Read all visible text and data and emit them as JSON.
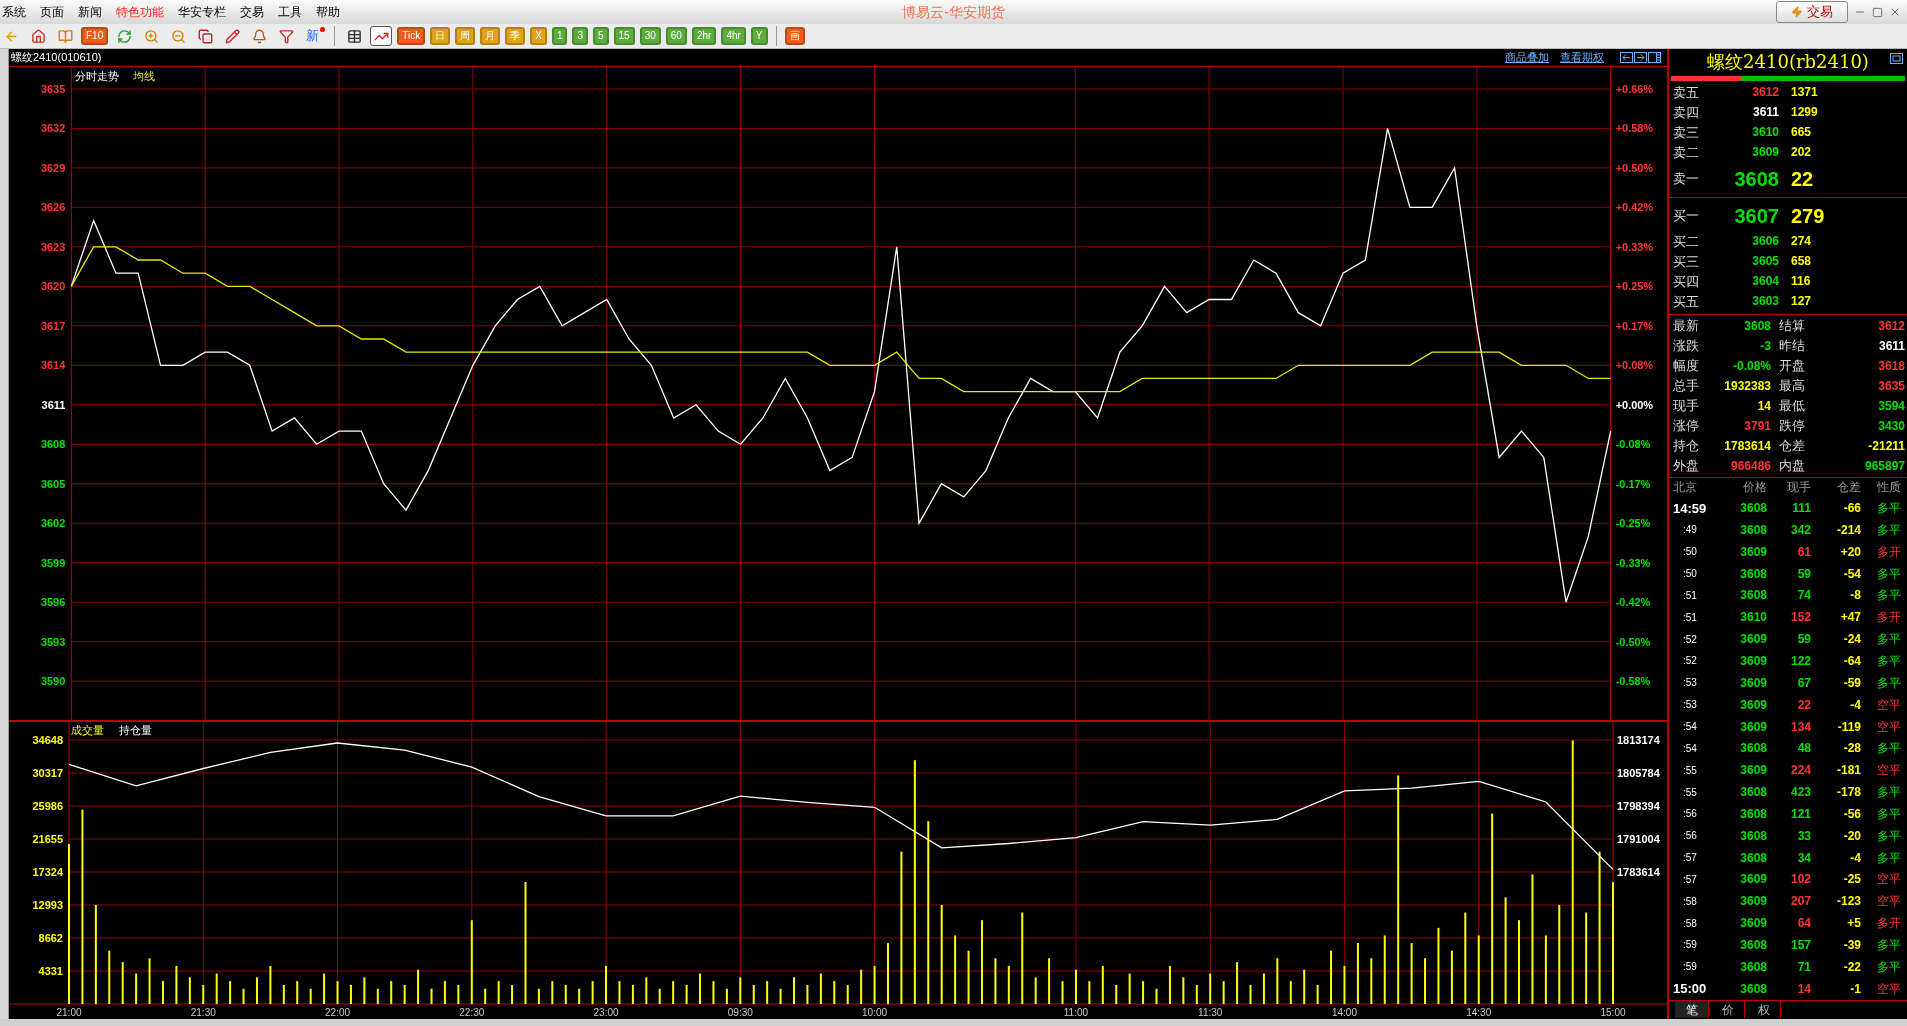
{
  "window": {
    "title": "博易云-华安期货",
    "trade_button": "交易"
  },
  "menu": [
    {
      "label": "系统",
      "selected": false
    },
    {
      "label": "页面",
      "selected": false
    },
    {
      "label": "新闻",
      "selected": false
    },
    {
      "label": "特色功能",
      "selected": true
    },
    {
      "label": "华安专栏",
      "selected": false
    },
    {
      "label": "交易",
      "selected": false
    },
    {
      "label": "工具",
      "selected": false
    },
    {
      "label": "帮助",
      "selected": false
    }
  ],
  "toolbar": [
    {
      "kind": "back",
      "selected": false
    },
    {
      "kind": "home",
      "selected": false
    },
    {
      "kind": "book",
      "selected": false
    },
    {
      "kind": "badge",
      "label": "F10",
      "color": "#e8601c",
      "selected": false
    },
    {
      "kind": "refresh",
      "selected": false
    },
    {
      "kind": "zoom-in",
      "selected": false
    },
    {
      "kind": "zoom-out",
      "selected": false
    },
    {
      "kind": "windows",
      "selected": false
    },
    {
      "kind": "pencil",
      "selected": false
    },
    {
      "kind": "bell",
      "selected": false
    },
    {
      "kind": "filter",
      "selected": false
    },
    {
      "kind": "news",
      "label": "新",
      "selected": false
    },
    {
      "kind": "sep"
    },
    {
      "kind": "table",
      "selected": false
    },
    {
      "kind": "chart",
      "selected": true
    },
    {
      "kind": "badge",
      "label": "Tick",
      "color": "#e8601c",
      "selected": false
    },
    {
      "kind": "badge",
      "label": "日",
      "color": "#e0a020",
      "selected": false
    },
    {
      "kind": "badge",
      "label": "周",
      "color": "#e0a020",
      "selected": false
    },
    {
      "kind": "badge",
      "label": "月",
      "color": "#e0a020",
      "selected": false
    },
    {
      "kind": "badge",
      "label": "季",
      "color": "#e0a020",
      "selected": false
    },
    {
      "kind": "badge",
      "label": "X",
      "color": "#e0a020",
      "selected": false
    },
    {
      "kind": "badge",
      "label": "1",
      "color": "#5cad3c",
      "selected": false
    },
    {
      "kind": "badge",
      "label": "3",
      "color": "#5cad3c",
      "selected": false
    },
    {
      "kind": "badge",
      "label": "5",
      "color": "#5cad3c",
      "selected": false
    },
    {
      "kind": "badge",
      "label": "15",
      "color": "#5cad3c",
      "selected": false
    },
    {
      "kind": "badge",
      "label": "30",
      "color": "#5cad3c",
      "selected": false
    },
    {
      "kind": "badge",
      "label": "60",
      "color": "#5cad3c",
      "selected": false
    },
    {
      "kind": "badge",
      "label": "2hr",
      "color": "#5cad3c",
      "selected": false
    },
    {
      "kind": "badge",
      "label": "4hr",
      "color": "#5cad3c",
      "selected": false
    },
    {
      "kind": "badge",
      "label": "Y",
      "color": "#5cad3c",
      "selected": false
    },
    {
      "kind": "sep"
    },
    {
      "kind": "badge",
      "label": "画",
      "color": "#e8601c",
      "selected": false
    }
  ],
  "chart_header": {
    "name": "螺纹2410(010610)",
    "links": [
      "商品叠加",
      "查看期权"
    ]
  },
  "price_panel": {
    "pct_labels": [
      {
        "text": "+0.66%",
        "color": "#ff3333"
      },
      {
        "text": "+0.58%",
        "color": "#ff3333"
      },
      {
        "text": "+0.50%",
        "color": "#ff3333"
      },
      {
        "text": "+0.42%",
        "color": "#ff3333"
      },
      {
        "text": "+0.33%",
        "color": "#ff3333"
      },
      {
        "text": "+0.25%",
        "color": "#ff3333"
      },
      {
        "text": "+0.17%",
        "color": "#ff3333"
      },
      {
        "text": "+0.08%",
        "color": "#ff3333"
      },
      {
        "text": "+0.00%",
        "color": "#ffffff"
      },
      {
        "text": "-0.08%",
        "color": "#00e000"
      },
      {
        "text": "-0.17%",
        "color": "#00e000"
      },
      {
        "text": "-0.25%",
        "color": "#00e000"
      },
      {
        "text": "-0.33%",
        "color": "#00e000"
      },
      {
        "text": "-0.42%",
        "color": "#00e000"
      },
      {
        "text": "-0.50%",
        "color": "#00e000"
      },
      {
        "text": "-0.58%",
        "color": "#00e000"
      }
    ],
    "chart_data": {
      "type": "line",
      "grid": true,
      "ylim": [
        3590,
        3635
      ],
      "yticks": [
        {
          "value": 3635,
          "label": "3635"
        },
        {
          "value": 3632,
          "label": "3632"
        },
        {
          "value": 3629,
          "label": "3629"
        },
        {
          "value": 3626,
          "label": "3626"
        },
        {
          "value": 3623,
          "label": "3623"
        },
        {
          "value": 3620,
          "label": "3620"
        },
        {
          "value": 3617,
          "label": "3617"
        },
        {
          "value": 3614,
          "label": "3614"
        },
        {
          "value": 3611,
          "label": "3611"
        },
        {
          "value": 3608,
          "label": "3608"
        },
        {
          "value": 3605,
          "label": "3605"
        },
        {
          "value": 3602,
          "label": "3602"
        },
        {
          "value": 3599,
          "label": "3599"
        },
        {
          "value": 3596,
          "label": "3596"
        },
        {
          "value": 3593,
          "label": "3593"
        },
        {
          "value": 3590,
          "label": "3590"
        }
      ],
      "categories": [
        null,
        null,
        null,
        null,
        null,
        null,
        null,
        null,
        null,
        null,
        null,
        null,
        null,
        null,
        null,
        null,
        null,
        null,
        null,
        null,
        null,
        null,
        null,
        null,
        null,
        null,
        null,
        null,
        null,
        null,
        null,
        null,
        null,
        null,
        null,
        null,
        null,
        null,
        null,
        null,
        null,
        null,
        null,
        null,
        null,
        null,
        null,
        null,
        null,
        null,
        null,
        null,
        null,
        null,
        null,
        null,
        null,
        null,
        null,
        null,
        null,
        null,
        null,
        null,
        null,
        null,
        null,
        null,
        null,
        null
      ],
      "series": [
        {
          "name": "分时走势",
          "color": "#ffffff",
          "values": [
            3620,
            3625,
            3621,
            3621,
            3614,
            3614,
            3615,
            3615,
            3614,
            3609,
            3610,
            3608,
            3609,
            3609,
            3605,
            3603,
            3606,
            3610,
            3614,
            3617,
            3619,
            3620,
            3617,
            3618,
            3619,
            3616,
            3614,
            3610,
            3611,
            3609,
            3608,
            3610,
            3613,
            3610,
            3606,
            3607,
            3612,
            3623,
            3602,
            3605,
            3604,
            3606,
            3610,
            3613,
            3612,
            3612,
            3610,
            3615,
            3617,
            3620,
            3618,
            3619,
            3619,
            3622,
            3621,
            3618,
            3617,
            3621,
            3622,
            3632,
            3626,
            3626,
            3629,
            3617,
            3607,
            3609,
            3607,
            3596,
            3601,
            3609
          ]
        },
        {
          "name": "均线",
          "color": "#e8e800",
          "values": [
            3620,
            3623,
            3623,
            3622,
            3622,
            3621,
            3621,
            3620,
            3620,
            3619,
            3618,
            3617,
            3617,
            3616,
            3616,
            3615,
            3615,
            3615,
            3615,
            3615,
            3615,
            3615,
            3615,
            3615,
            3615,
            3615,
            3615,
            3615,
            3615,
            3615,
            3615,
            3615,
            3615,
            3615,
            3614,
            3614,
            3614,
            3615,
            3613,
            3613,
            3612,
            3612,
            3612,
            3612,
            3612,
            3612,
            3612,
            3612,
            3613,
            3613,
            3613,
            3613,
            3613,
            3613,
            3613,
            3614,
            3614,
            3614,
            3614,
            3614,
            3614,
            3615,
            3615,
            3615,
            3615,
            3614,
            3614,
            3614,
            3613,
            3613
          ]
        }
      ]
    }
  },
  "volume_panel": {
    "chart_data": {
      "type": "bar",
      "grid": true,
      "ylim": [
        0,
        34648
      ],
      "yticks": [
        {
          "value": 34648,
          "label": "34648"
        },
        {
          "value": 30317,
          "label": "30317"
        },
        {
          "value": 25986,
          "label": "25986"
        },
        {
          "value": 21655,
          "label": "21655"
        },
        {
          "value": 17324,
          "label": "17324"
        },
        {
          "value": 12993,
          "label": "12993"
        },
        {
          "value": 8662,
          "label": "8662"
        },
        {
          "value": 4331,
          "label": "4331"
        }
      ],
      "categories": [
        "21:00",
        null,
        null,
        null,
        null,
        null,
        null,
        null,
        null,
        null,
        "21:30",
        null,
        null,
        null,
        null,
        null,
        null,
        null,
        null,
        null,
        "22:00",
        null,
        null,
        null,
        null,
        null,
        null,
        null,
        null,
        null,
        "22:30",
        null,
        null,
        null,
        null,
        null,
        null,
        null,
        null,
        null,
        "23:00",
        null,
        null,
        null,
        null,
        null,
        null,
        null,
        null,
        null,
        "09:30",
        null,
        null,
        null,
        null,
        null,
        null,
        null,
        null,
        null,
        "10:00",
        null,
        null,
        null,
        null,
        null,
        null,
        null,
        null,
        null,
        null,
        null,
        null,
        null,
        null,
        "11:00",
        null,
        null,
        null,
        null,
        null,
        null,
        null,
        null,
        null,
        "11:30",
        null,
        null,
        null,
        null,
        null,
        null,
        null,
        null,
        null,
        "14:00",
        null,
        null,
        null,
        null,
        null,
        null,
        null,
        null,
        null,
        "14:30",
        null,
        null,
        null,
        null,
        null,
        null,
        null,
        null,
        null,
        "15:00"
      ],
      "series": [
        {
          "name": "成交量",
          "color": "#ffff00",
          "values": [
            21000,
            25500,
            13000,
            7000,
            5500,
            4000,
            6000,
            3000,
            5000,
            3500,
            2500,
            4000,
            3000,
            2000,
            3500,
            5000,
            2500,
            3000,
            2000,
            4000,
            3000,
            2500,
            3500,
            2000,
            3000,
            2500,
            4500,
            2000,
            3000,
            2500,
            11000,
            2000,
            3000,
            2500,
            16000,
            2000,
            3000,
            2500,
            2000,
            3000,
            5000,
            3000,
            2500,
            3500,
            2000,
            3000,
            2500,
            4000,
            3000,
            2000,
            3500,
            2500,
            3000,
            2000,
            3500,
            2500,
            4000,
            3000,
            2500,
            4500,
            5000,
            8000,
            20000,
            32000,
            24000,
            13000,
            9000,
            7000,
            11000,
            6000,
            5000,
            12000,
            3500,
            6000,
            3000,
            4500,
            3000,
            5000,
            2500,
            4000,
            3000,
            2000,
            5000,
            3500,
            2500,
            4000,
            3000,
            5500,
            2500,
            4000,
            6000,
            3000,
            4500,
            2500,
            7000,
            5000,
            8000,
            6000,
            9000,
            30000,
            8000,
            6000,
            10000,
            7000,
            12000,
            9000,
            25000,
            14000,
            11000,
            17000,
            9000,
            13000,
            34600,
            12000,
            20000,
            16000
          ]
        }
      ]
    },
    "open_interest": {
      "chart_data": {
        "type": "line",
        "ylim": [
          1783614,
          1813174
        ],
        "yticks": [
          {
            "value": 1813174,
            "label": "1813174"
          },
          {
            "value": 1805784,
            "label": "1805784"
          },
          {
            "value": 1798394,
            "label": "1798394"
          },
          {
            "value": 1791004,
            "label": "1791004"
          },
          {
            "value": 1783614,
            "label": "1783614"
          }
        ],
        "categories": [
          null,
          null,
          null,
          null,
          null,
          null,
          null,
          null,
          null,
          null,
          null,
          null,
          null,
          null,
          null,
          null,
          null,
          null,
          null,
          null,
          null,
          null,
          null,
          null
        ],
        "series": [
          {
            "name": "持仓量",
            "color": "#ffffff",
            "values": [
              1807700,
              1802900,
              1806800,
              1810400,
              1812500,
              1810900,
              1807100,
              1800500,
              1796200,
              1796200,
              1800600,
              1799200,
              1798100,
              1789000,
              1790000,
              1791300,
              1794900,
              1794100,
              1795400,
              1801800,
              1802400,
              1803900,
              1799300,
              1784200
            ]
          }
        ]
      }
    }
  },
  "quote": {
    "title": "螺纹2410(rb2410)",
    "buy_sell_bar": {
      "level": 0.3
    },
    "asks": [
      {
        "label": "卖五",
        "price": "3612",
        "volume": "1371",
        "color": "#ff3333",
        "kind": "small"
      },
      {
        "label": "卖四",
        "price": "3611",
        "volume": "1299",
        "color": "#ffffff",
        "kind": "small"
      },
      {
        "label": "卖三",
        "price": "3610",
        "volume": "665",
        "color": "#00e000",
        "kind": "small"
      },
      {
        "label": "卖二",
        "price": "3609",
        "volume": "202",
        "color": "#00e000",
        "kind": "small"
      },
      {
        "label": "卖一",
        "price": "3608",
        "volume": "22",
        "color": "#00e000",
        "kind": "big"
      }
    ],
    "bids": [
      {
        "label": "买一",
        "price": "3607",
        "volume": "279",
        "color": "#00e000",
        "kind": "big"
      },
      {
        "label": "买二",
        "price": "3606",
        "volume": "274",
        "color": "#00e000",
        "kind": "small"
      },
      {
        "label": "买三",
        "price": "3605",
        "volume": "658",
        "color": "#00e000",
        "kind": "small"
      },
      {
        "label": "买四",
        "price": "3604",
        "volume": "116",
        "color": "#00e000",
        "kind": "small"
      },
      {
        "label": "买五",
        "price": "3603",
        "volume": "127",
        "color": "#00e000",
        "kind": "small"
      }
    ],
    "stats": [
      {
        "label": "最新",
        "value": "3608",
        "color": "#00e000"
      },
      {
        "label": "结算",
        "value": "3612",
        "color": "#ff3333"
      },
      {
        "label": "涨跌",
        "value": "-3",
        "color": "#00e000"
      },
      {
        "label": "昨结",
        "value": "3611",
        "color": "#ffffff"
      },
      {
        "label": "幅度",
        "value": "-0.08%",
        "color": "#00e000"
      },
      {
        "label": "开盘",
        "value": "3618",
        "color": "#ff3333"
      },
      {
        "label": "总手",
        "value": "1932383",
        "color": "#ffff00"
      },
      {
        "label": "最高",
        "value": "3635",
        "color": "#ff3333"
      },
      {
        "label": "现手",
        "value": "14",
        "color": "#ffff00"
      },
      {
        "label": "最低",
        "value": "3594",
        "color": "#00e000"
      },
      {
        "label": "涨停",
        "value": "3791",
        "color": "#ff3333"
      },
      {
        "label": "跌停",
        "value": "3430",
        "color": "#00e000"
      },
      {
        "label": "持仓",
        "value": "1783614",
        "color": "#ffff00"
      },
      {
        "label": "仓差",
        "value": "-21211",
        "color": "#ffff00"
      },
      {
        "label": "外盘",
        "value": "966486",
        "color": "#ff3333"
      },
      {
        "label": "内盘",
        "value": "965897",
        "color": "#00e000"
      }
    ],
    "tick_columns": [
      "北京",
      "价格",
      "现手",
      "仓差",
      "性质"
    ],
    "ticks": [
      {
        "time": "14:59",
        "kind": "full",
        "price": "3608",
        "vol": "111",
        "diff": "-66",
        "nature": "多平",
        "color": "#00e000"
      },
      {
        "time": ":49",
        "kind": "sub",
        "price": "3608",
        "vol": "342",
        "diff": "-214",
        "nature": "多平",
        "color": "#00e000"
      },
      {
        "time": ":50",
        "kind": "sub",
        "price": "3609",
        "vol": "61",
        "diff": "+20",
        "nature": "多开",
        "color": "#ff3333"
      },
      {
        "time": ":50",
        "kind": "sub",
        "price": "3608",
        "vol": "59",
        "diff": "-54",
        "nature": "多平",
        "color": "#00e000"
      },
      {
        "time": ":51",
        "kind": "sub",
        "price": "3608",
        "vol": "74",
        "diff": "-8",
        "nature": "多平",
        "color": "#00e000"
      },
      {
        "time": ":51",
        "kind": "sub",
        "price": "3610",
        "vol": "152",
        "diff": "+47",
        "nature": "多开",
        "color": "#ff3333"
      },
      {
        "time": ":52",
        "kind": "sub",
        "price": "3609",
        "vol": "59",
        "diff": "-24",
        "nature": "多平",
        "color": "#00e000"
      },
      {
        "time": ":52",
        "kind": "sub",
        "price": "3609",
        "vol": "122",
        "diff": "-64",
        "nature": "多平",
        "color": "#00e000"
      },
      {
        "time": ":53",
        "kind": "sub",
        "price": "3609",
        "vol": "67",
        "diff": "-59",
        "nature": "多平",
        "color": "#00e000"
      },
      {
        "time": ":53",
        "kind": "sub",
        "price": "3609",
        "vol": "22",
        "diff": "-4",
        "nature": "空平",
        "color": "#ff3333"
      },
      {
        "time": ":54",
        "kind": "sub",
        "price": "3609",
        "vol": "134",
        "diff": "-119",
        "nature": "空平",
        "color": "#ff3333"
      },
      {
        "time": ":54",
        "kind": "sub",
        "price": "3608",
        "vol": "48",
        "diff": "-28",
        "nature": "多平",
        "color": "#00e000"
      },
      {
        "time": ":55",
        "kind": "sub",
        "price": "3609",
        "vol": "224",
        "diff": "-181",
        "nature": "空平",
        "color": "#ff3333"
      },
      {
        "time": ":55",
        "kind": "sub",
        "price": "3608",
        "vol": "423",
        "diff": "-178",
        "nature": "多平",
        "color": "#00e000"
      },
      {
        "time": ":56",
        "kind": "sub",
        "price": "3608",
        "vol": "121",
        "diff": "-56",
        "nature": "多平",
        "color": "#00e000"
      },
      {
        "time": ":56",
        "kind": "sub",
        "price": "3608",
        "vol": "33",
        "diff": "-20",
        "nature": "多平",
        "color": "#00e000"
      },
      {
        "time": ":57",
        "kind": "sub",
        "price": "3608",
        "vol": "34",
        "diff": "-4",
        "nature": "多平",
        "color": "#00e000"
      },
      {
        "time": ":57",
        "kind": "sub",
        "price": "3609",
        "vol": "102",
        "diff": "-25",
        "nature": "空平",
        "color": "#ff3333"
      },
      {
        "time": ":58",
        "kind": "sub",
        "price": "3609",
        "vol": "207",
        "diff": "-123",
        "nature": "空平",
        "color": "#ff3333"
      },
      {
        "time": ":58",
        "kind": "sub",
        "price": "3609",
        "vol": "64",
        "diff": "+5",
        "nature": "多开",
        "color": "#ff3333"
      },
      {
        "time": ":59",
        "kind": "sub",
        "price": "3608",
        "vol": "157",
        "diff": "-39",
        "nature": "多平",
        "color": "#00e000"
      },
      {
        "time": ":59",
        "kind": "sub",
        "price": "3608",
        "vol": "71",
        "diff": "-22",
        "nature": "多平",
        "color": "#00e000"
      },
      {
        "time": "15:00",
        "kind": "full",
        "price": "3608",
        "vol": "14",
        "diff": "-1",
        "nature": "空平",
        "color": "#ff3333"
      }
    ],
    "tabs": [
      {
        "label": "笔",
        "selected": true
      },
      {
        "label": "价",
        "selected": false
      },
      {
        "label": "权",
        "selected": false
      }
    ]
  }
}
